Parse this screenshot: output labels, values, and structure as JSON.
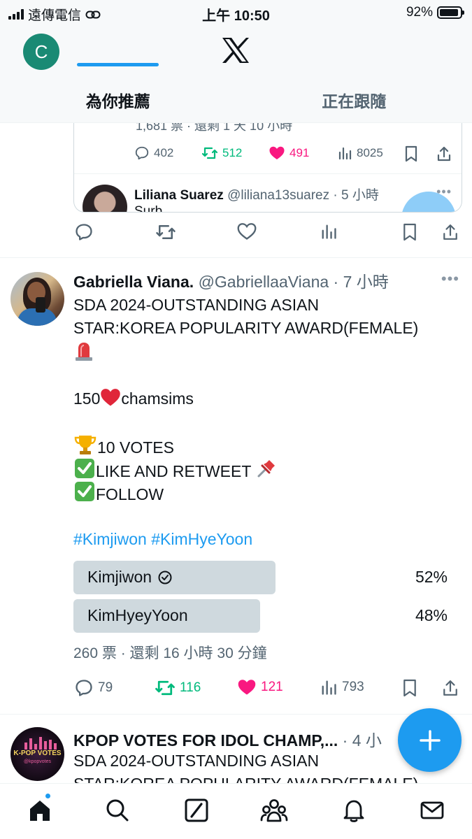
{
  "status_bar": {
    "carrier": "遠傳電信",
    "time": "上午 10:50",
    "battery": "92%",
    "battery_level": 0.92
  },
  "header": {
    "account_initial": "C",
    "tabs": [
      {
        "label": "為你推薦",
        "active": true
      },
      {
        "label": "正在跟隨",
        "active": false
      }
    ]
  },
  "quoted_tweet": {
    "cut_text": "1,681 票 · 還剩 1 天 10 小時",
    "stats": {
      "replies": "402",
      "retweets": "512",
      "likes": "491",
      "views": "8025"
    },
    "reply": {
      "name": "Liliana Suarez",
      "handle": "@liliana13suarez · 5 小時",
      "text": "Surb..."
    }
  },
  "tweet": {
    "name": "Gabriella Viana.",
    "handle": "@GabriellaaViana · 7 小時",
    "lines": {
      "l1": "SDA 2024-OUTSTANDING ASIAN",
      "l2": "STAR:KOREA POPULARITY AWARD(FEMALE)",
      "l4_pre": "150",
      "l4_post": "chamsims",
      "l6": "10 VOTES",
      "l7": "LIKE AND RETWEET ",
      "l8": "FOLLOW"
    },
    "hashtags": "#Kimjiwon #KimHyeYoon",
    "poll": {
      "options": [
        {
          "label": "Kimjiwon",
          "percent": "52%",
          "fraction": 0.52,
          "selected": true
        },
        {
          "label": "KimHyeyYoon",
          "percent": "48%",
          "fraction": 0.48,
          "selected": false
        }
      ],
      "meta": "260 票 · 還剩 16 小時 30 分鐘"
    },
    "stats": {
      "replies": "79",
      "retweets": "116",
      "likes": "121",
      "views": "793"
    }
  },
  "next_tweet": {
    "name": "KPOP VOTES FOR IDOL CHAMP,...",
    "handle": " · 4 小",
    "line1": "SDA 2024-OUTSTANDING ASIAN",
    "line2": "STAR:KOREA POPULARITY AWARD(FEMALE)",
    "avatar_text": "K-POP VOTES",
    "avatar_subtext": "@kpopvotes"
  },
  "colors": {
    "accent": "#1d9bf0",
    "retweet": "#00ba7c",
    "like": "#f91880",
    "muted": "#536471"
  },
  "icons": {
    "nav": [
      "home-icon",
      "search-icon",
      "grok-icon",
      "communities-icon",
      "notifications-icon",
      "messages-icon"
    ]
  }
}
